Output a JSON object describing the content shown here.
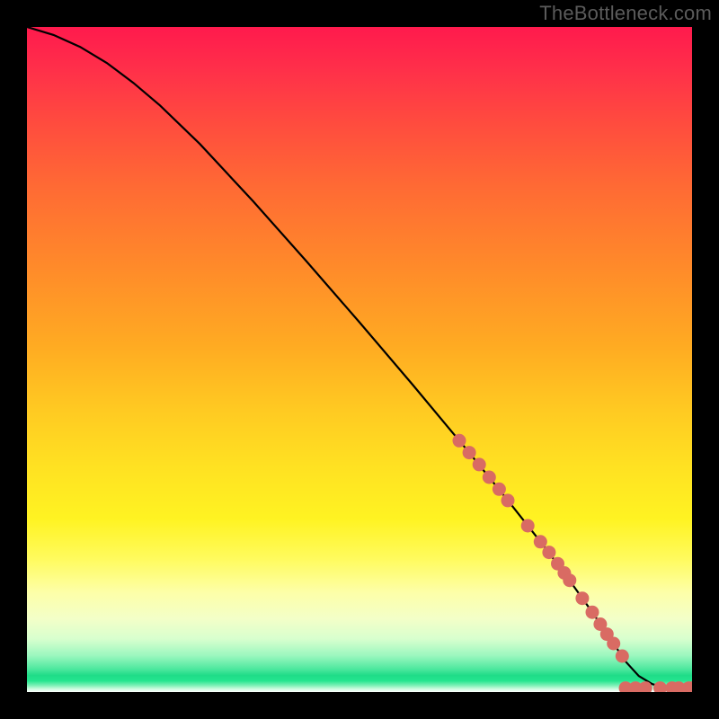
{
  "watermark": "TheBottleneck.com",
  "chart_data": {
    "type": "line",
    "title": "",
    "xlabel": "",
    "ylabel": "",
    "x_range": [
      0,
      100
    ],
    "y_range": [
      0,
      100
    ],
    "curve": {
      "x": [
        0,
        4,
        8,
        12,
        16,
        20,
        26,
        34,
        42,
        50,
        58,
        66,
        72,
        78,
        82,
        85,
        88,
        90,
        92,
        94,
        96,
        98,
        100
      ],
      "y": [
        100,
        98.8,
        97.0,
        94.6,
        91.6,
        88.2,
        82.4,
        73.8,
        64.8,
        55.6,
        46.2,
        36.6,
        29.2,
        21.6,
        16.2,
        12.0,
        7.6,
        4.6,
        2.4,
        1.2,
        0.6,
        0.6,
        0.6
      ]
    },
    "highlight_points": {
      "color": "#d96b63",
      "points": [
        {
          "x": 65.0,
          "y": 37.8
        },
        {
          "x": 66.5,
          "y": 36.0
        },
        {
          "x": 68.0,
          "y": 34.2
        },
        {
          "x": 69.5,
          "y": 32.3
        },
        {
          "x": 71.0,
          "y": 30.5
        },
        {
          "x": 72.3,
          "y": 28.8
        },
        {
          "x": 75.3,
          "y": 25.0
        },
        {
          "x": 77.2,
          "y": 22.6
        },
        {
          "x": 78.5,
          "y": 21.0
        },
        {
          "x": 79.8,
          "y": 19.3
        },
        {
          "x": 80.8,
          "y": 17.9
        },
        {
          "x": 81.6,
          "y": 16.8
        },
        {
          "x": 83.5,
          "y": 14.1
        },
        {
          "x": 85.0,
          "y": 12.0
        },
        {
          "x": 86.2,
          "y": 10.2
        },
        {
          "x": 87.2,
          "y": 8.7
        },
        {
          "x": 88.2,
          "y": 7.3
        },
        {
          "x": 89.5,
          "y": 5.4
        },
        {
          "x": 90.0,
          "y": 0.6
        },
        {
          "x": 91.5,
          "y": 0.6
        },
        {
          "x": 93.0,
          "y": 0.6
        },
        {
          "x": 95.2,
          "y": 0.6
        },
        {
          "x": 97.0,
          "y": 0.6
        },
        {
          "x": 98.0,
          "y": 0.6
        },
        {
          "x": 99.5,
          "y": 0.6
        },
        {
          "x": 100.0,
          "y": 0.6
        }
      ]
    }
  }
}
